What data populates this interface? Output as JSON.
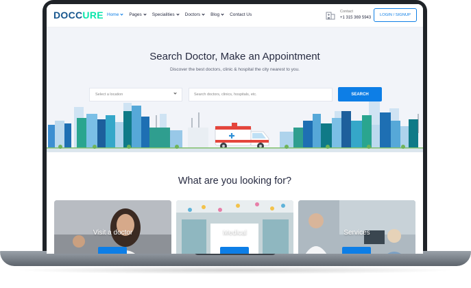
{
  "brand": {
    "part1": "DOCC",
    "part2": "URE",
    "primary_color": "#15558d",
    "accent_color": "#09e5ab"
  },
  "nav": {
    "items": [
      {
        "label": "Home",
        "active": true
      },
      {
        "label": "Pages",
        "active": false
      },
      {
        "label": "Specialities",
        "active": false
      },
      {
        "label": "Doctors",
        "active": false
      },
      {
        "label": "Blog",
        "active": false
      },
      {
        "label": "Contact Us",
        "active": false
      }
    ]
  },
  "header": {
    "contact_label": "Contact",
    "contact_phone": "+1 315 369 5943",
    "login_label": "LOGIN / SIGNUP",
    "contact_icon": "hospital-icon"
  },
  "hero": {
    "title": "Search Doctor, Make an Appointment",
    "subtitle": "Discover the best doctors, clinic & hospital the city nearest to you.",
    "location_placeholder": "Select a location",
    "search_placeholder": "Search doctors, clinics, hospitals, etc.",
    "search_button": "SEARCH",
    "button_color": "#0d7ee6"
  },
  "section": {
    "title": "What are you looking for?",
    "cards": [
      {
        "label": "Visit a doctor"
      },
      {
        "label": "Medical"
      },
      {
        "label": "Services"
      }
    ]
  }
}
